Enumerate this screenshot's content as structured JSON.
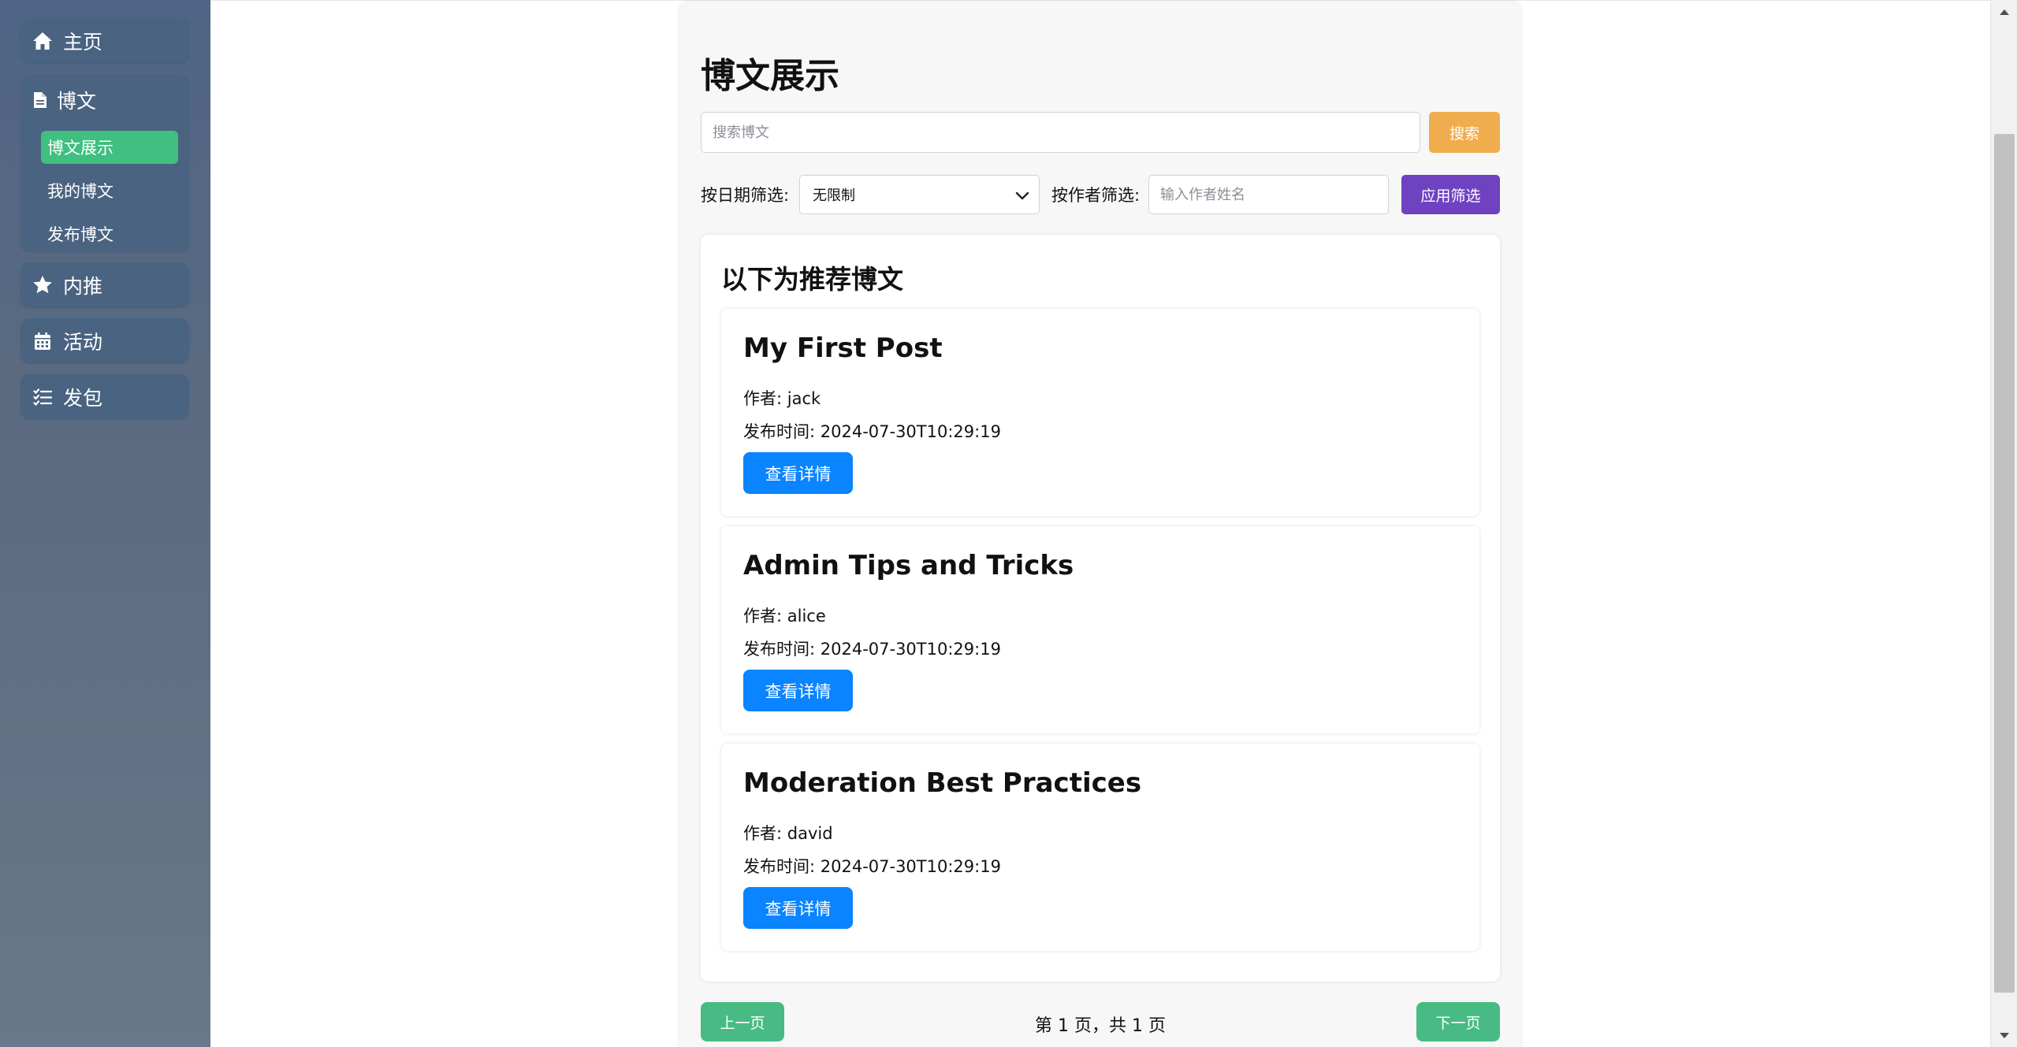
{
  "sidebar": {
    "home": {
      "label": "主页",
      "icon": "home-icon"
    },
    "blog": {
      "label": "博文",
      "icon": "file-icon",
      "items": [
        {
          "label": "博文展示",
          "active": true
        },
        {
          "label": "我的博文",
          "active": false
        },
        {
          "label": "发布博文",
          "active": false
        }
      ]
    },
    "referral": {
      "label": "内推",
      "icon": "star-icon"
    },
    "events": {
      "label": "活动",
      "icon": "calendar-icon"
    },
    "tasks": {
      "label": "发包",
      "icon": "checklist-icon"
    }
  },
  "main": {
    "title": "博文展示",
    "search": {
      "placeholder": "搜索博文",
      "button": "搜索"
    },
    "filters": {
      "date_label": "按日期筛选:",
      "date_value": "无限制",
      "author_label": "按作者筛选:",
      "author_placeholder": "输入作者姓名",
      "apply_button": "应用筛选"
    },
    "recommended_title": "以下为推荐博文",
    "posts": [
      {
        "title": "My First Post",
        "author": "作者: jack",
        "time": "发布时间: 2024-07-30T10:29:19",
        "button": "查看详情"
      },
      {
        "title": "Admin Tips and Tricks",
        "author": "作者: alice",
        "time": "发布时间: 2024-07-30T10:29:19",
        "button": "查看详情"
      },
      {
        "title": "Moderation Best Practices",
        "author": "作者: david",
        "time": "发布时间: 2024-07-30T10:29:19",
        "button": "查看详情"
      }
    ],
    "pagination": {
      "prev": "上一页",
      "info": "第 1 页，共 1 页",
      "next": "下一页"
    }
  },
  "colors": {
    "sidebar_bg": "#5c6b80",
    "active_item": "#3fbf80",
    "search_button": "#f0ad4e",
    "apply_button": "#6f42c1",
    "detail_button": "#0a84ff",
    "page_button": "#48bb84"
  }
}
